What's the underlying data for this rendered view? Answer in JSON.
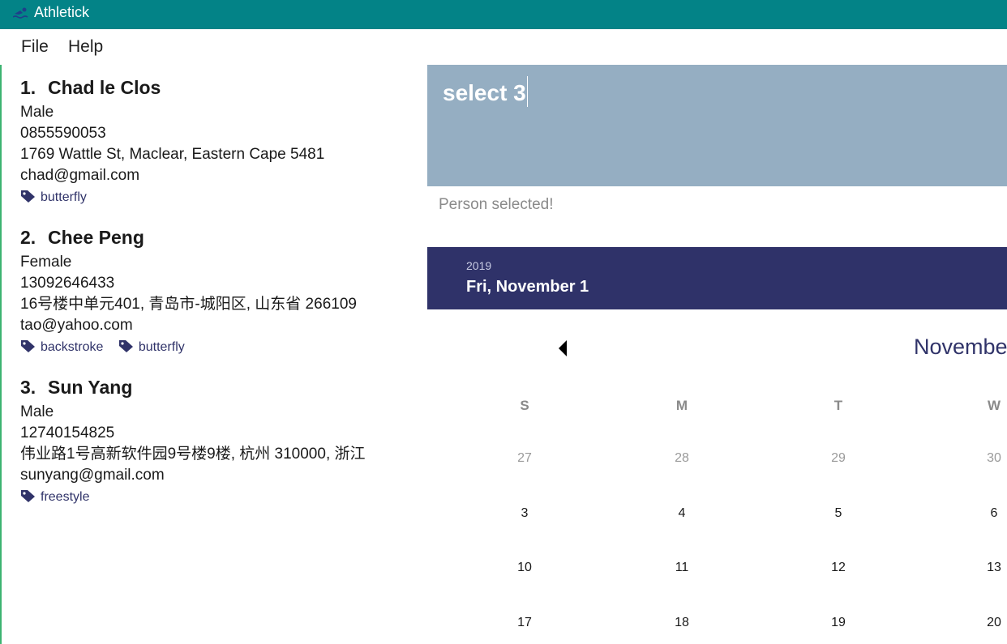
{
  "window": {
    "title": "Athletick",
    "icon": "swimmer-icon"
  },
  "menu": {
    "file": "File",
    "help": "Help"
  },
  "persons": [
    {
      "index": "1.",
      "name": "Chad le Clos",
      "gender": "Male",
      "phone": "0855590053",
      "address": "1769 Wattle St, Maclear, Eastern Cape 5481",
      "email": "chad@gmail.com",
      "tags": [
        "butterfly"
      ]
    },
    {
      "index": "2.",
      "name": "Chee Peng",
      "gender": "Female",
      "phone": "13092646433",
      "address": "16号楼中单元401, 青岛市-城阳区, 山东省 266109",
      "email": "tao@yahoo.com",
      "tags": [
        "backstroke",
        "butterfly"
      ]
    },
    {
      "index": "3.",
      "name": "Sun Yang",
      "gender": "Male",
      "phone": "12740154825",
      "address": "伟业路1号高新软件园9号楼9楼, 杭州 310000, 浙江",
      "email": "sunyang@gmail.com",
      "tags": [
        "freestyle"
      ]
    }
  ],
  "command": {
    "value": "select 3"
  },
  "result": {
    "message": "Person selected!"
  },
  "calendar": {
    "year": "2019",
    "selected_date": "Fri, November 1",
    "month_label": "Novembe",
    "weekdays": [
      "S",
      "M",
      "T",
      "W"
    ],
    "weeks": [
      [
        "27",
        "28",
        "29",
        "30"
      ],
      [
        "3",
        "4",
        "5",
        "6"
      ],
      [
        "10",
        "11",
        "12",
        "13"
      ],
      [
        "17",
        "18",
        "19",
        "20"
      ]
    ]
  },
  "colors": {
    "titlebar": "#038387",
    "accent": "#303369",
    "command_box": "#95aec2",
    "calendar_header": "#2f3269"
  }
}
